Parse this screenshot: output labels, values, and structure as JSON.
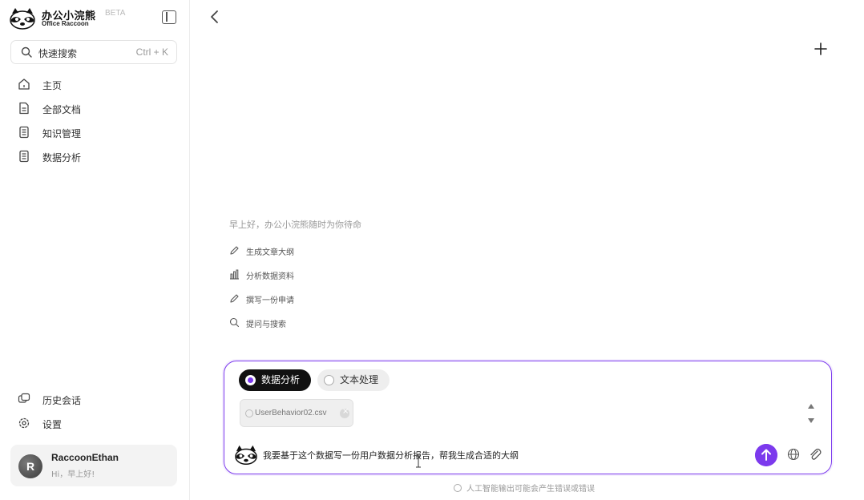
{
  "brand": {
    "name": "办公小浣熊",
    "badge": "BETA",
    "subtitle": "Office Raccoon"
  },
  "search": {
    "label": "快速搜索",
    "shortcut": "Ctrl + K"
  },
  "nav": {
    "items": [
      {
        "label": "主页",
        "icon": "home-icon"
      },
      {
        "label": "全部文档",
        "icon": "document-icon"
      },
      {
        "label": "知识管理",
        "icon": "book-icon"
      },
      {
        "label": "数据分析",
        "icon": "chart-doc-icon"
      }
    ]
  },
  "bottom_nav": {
    "history": "历史会话",
    "settings": "设置"
  },
  "user": {
    "initial": "R",
    "name": "RaccoonEthan",
    "greeting": "Hi，早上好!"
  },
  "main": {
    "greeting": "早上好，办公小浣熊随时为你待命",
    "suggestions": [
      {
        "label": "生成文章大纲",
        "icon": "pencil-icon"
      },
      {
        "label": "分析数据资料",
        "icon": "bar-chart-icon"
      },
      {
        "label": "撰写一份申请",
        "icon": "pencil-icon"
      },
      {
        "label": "提问与搜索",
        "icon": "search-icon"
      }
    ]
  },
  "composer": {
    "modes": [
      {
        "label": "数据分析",
        "active": true
      },
      {
        "label": "文本处理",
        "active": false
      }
    ],
    "attachment": "UserBehavior02.csv",
    "input_text": "我要基于这个数据写一份用户数据分析报告，帮我生成合适的大纲",
    "accent": "#7c3aed"
  },
  "disclaimer": "人工智能输出可能会产生错误或错误"
}
